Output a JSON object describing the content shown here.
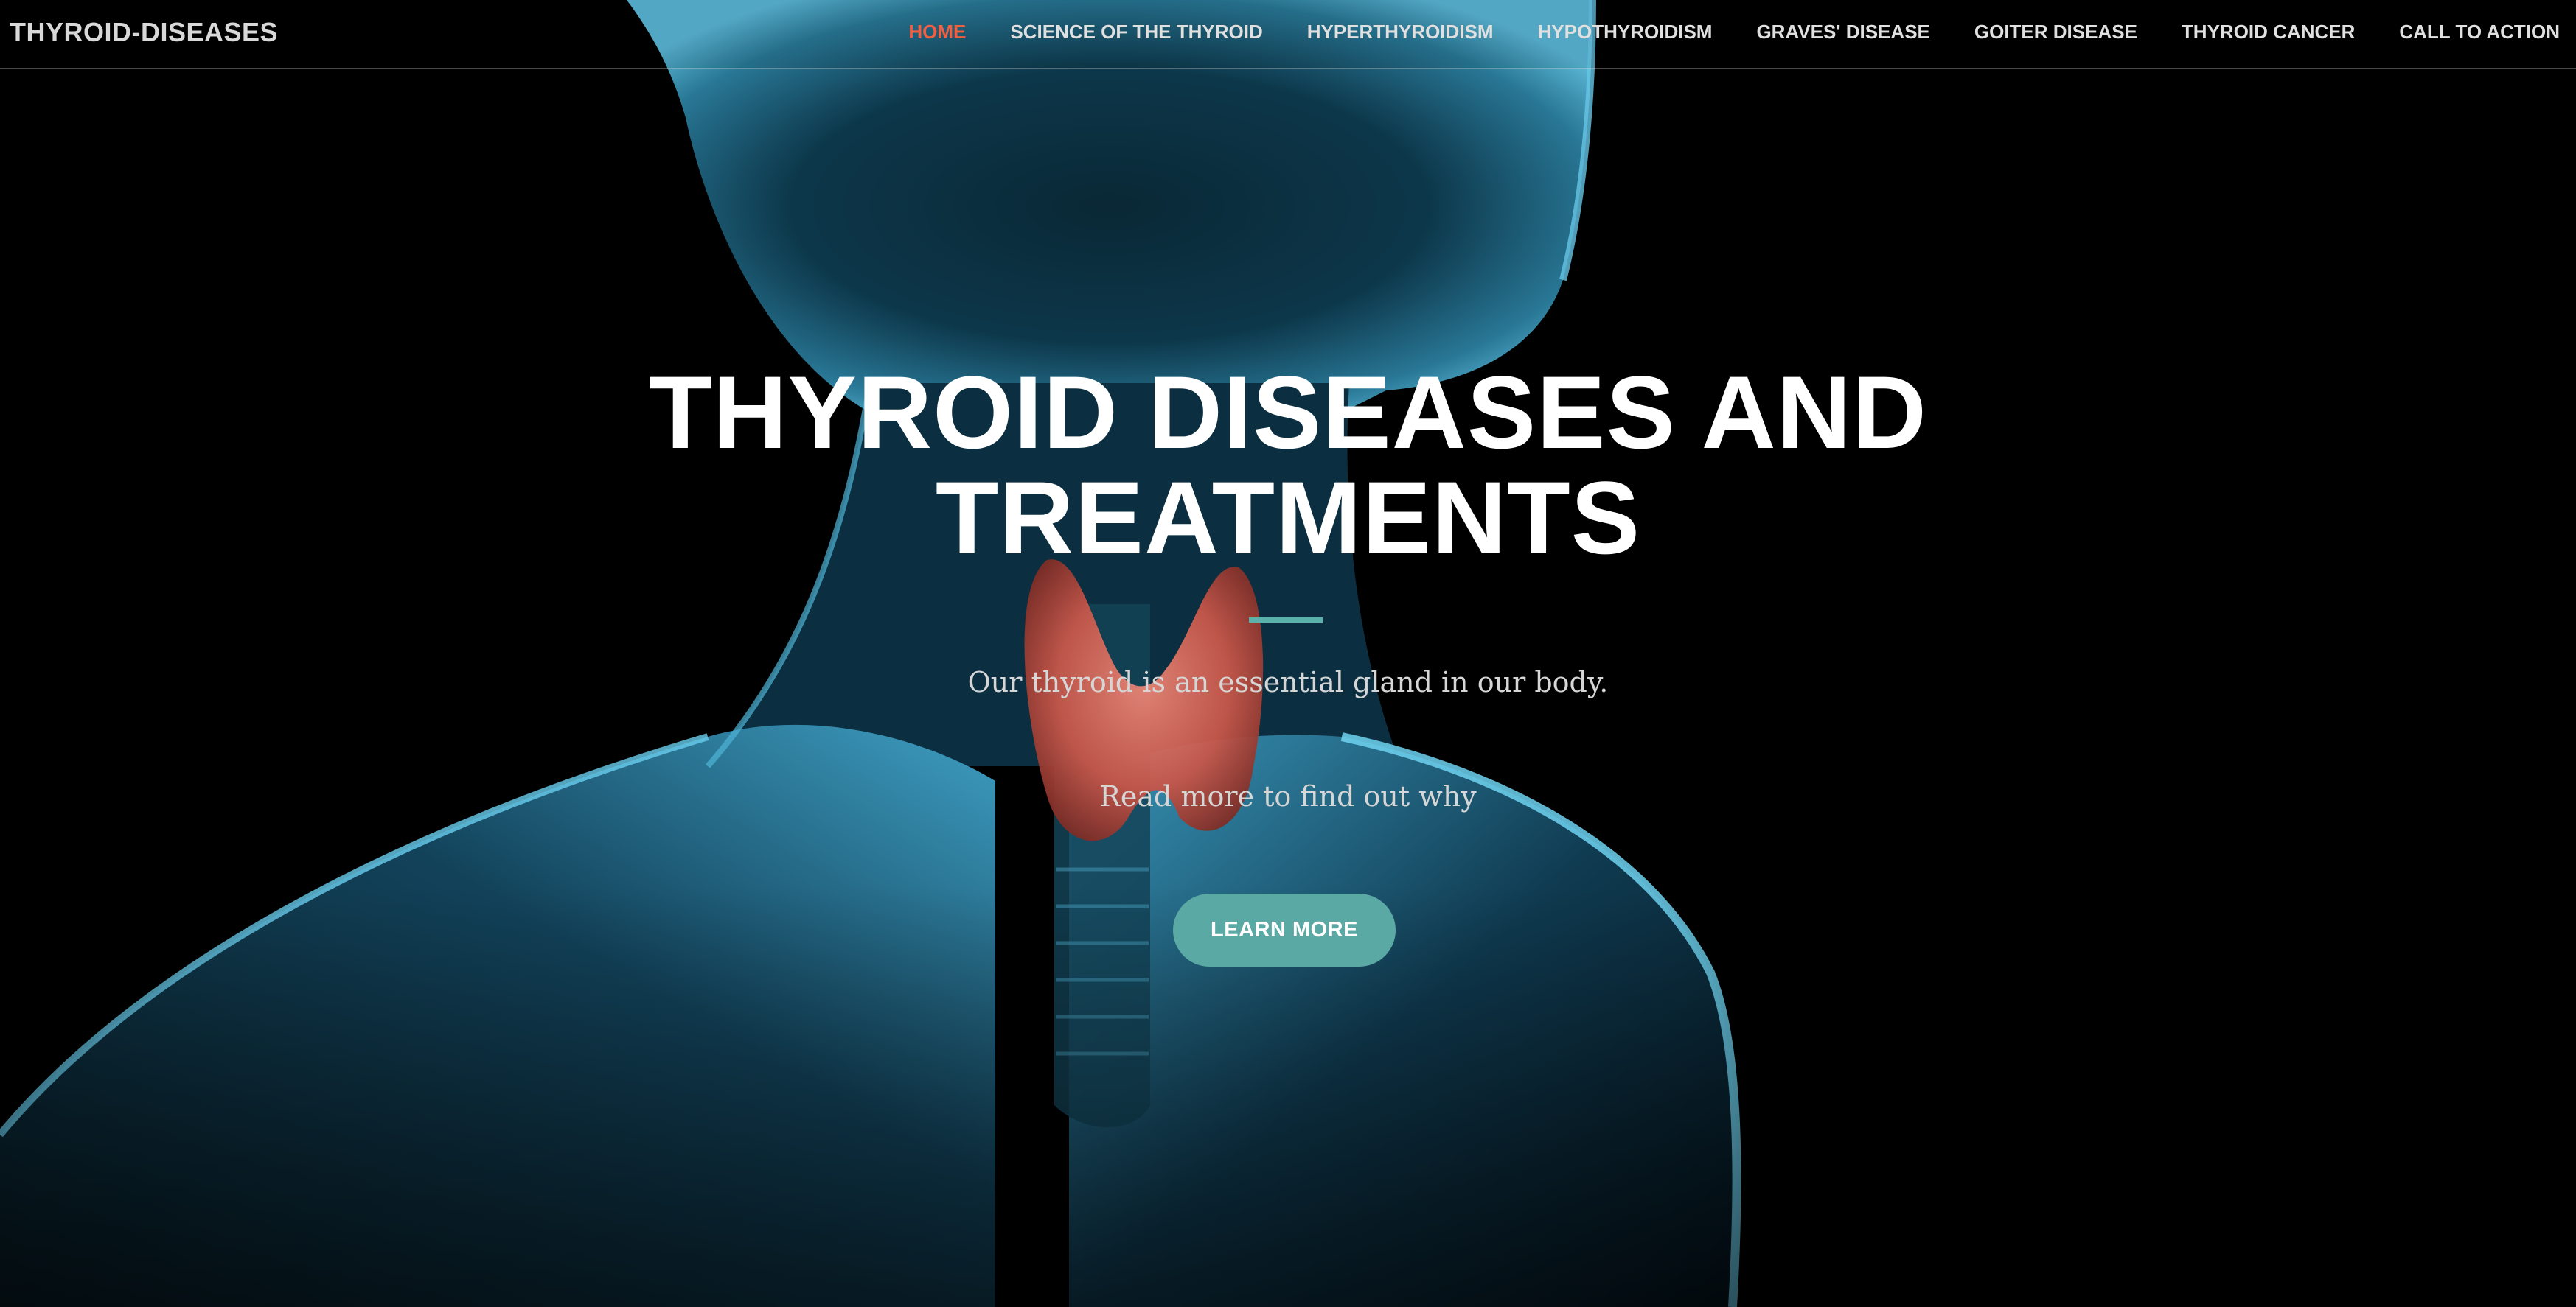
{
  "site": {
    "brand": "THYROID-DISEASES"
  },
  "nav": {
    "items": [
      {
        "label": "HOME",
        "active": true
      },
      {
        "label": "SCIENCE OF THE THYROID",
        "active": false
      },
      {
        "label": "HYPERTHYROIDISM",
        "active": false
      },
      {
        "label": "HYPOTHYROIDISM",
        "active": false
      },
      {
        "label": "GRAVES' DISEASE",
        "active": false
      },
      {
        "label": "GOITER DISEASE",
        "active": false
      },
      {
        "label": "THYROID CANCER",
        "active": false
      },
      {
        "label": "CALL TO ACTION",
        "active": false
      }
    ]
  },
  "hero": {
    "title_line1": "THYROID DISEASES AND",
    "title_line2": "TREATMENTS",
    "subtitle": "Our thyroid is an essential gland in our body.",
    "subtitle2": "Read more to find out why",
    "cta_label": "LEARN MORE",
    "background_image": "human-neck-thyroid-xray-illustration"
  },
  "colors": {
    "accent": "#f05f40",
    "button": "#5ba9a4",
    "divider": "#5ab2ab",
    "background": "#000000"
  }
}
